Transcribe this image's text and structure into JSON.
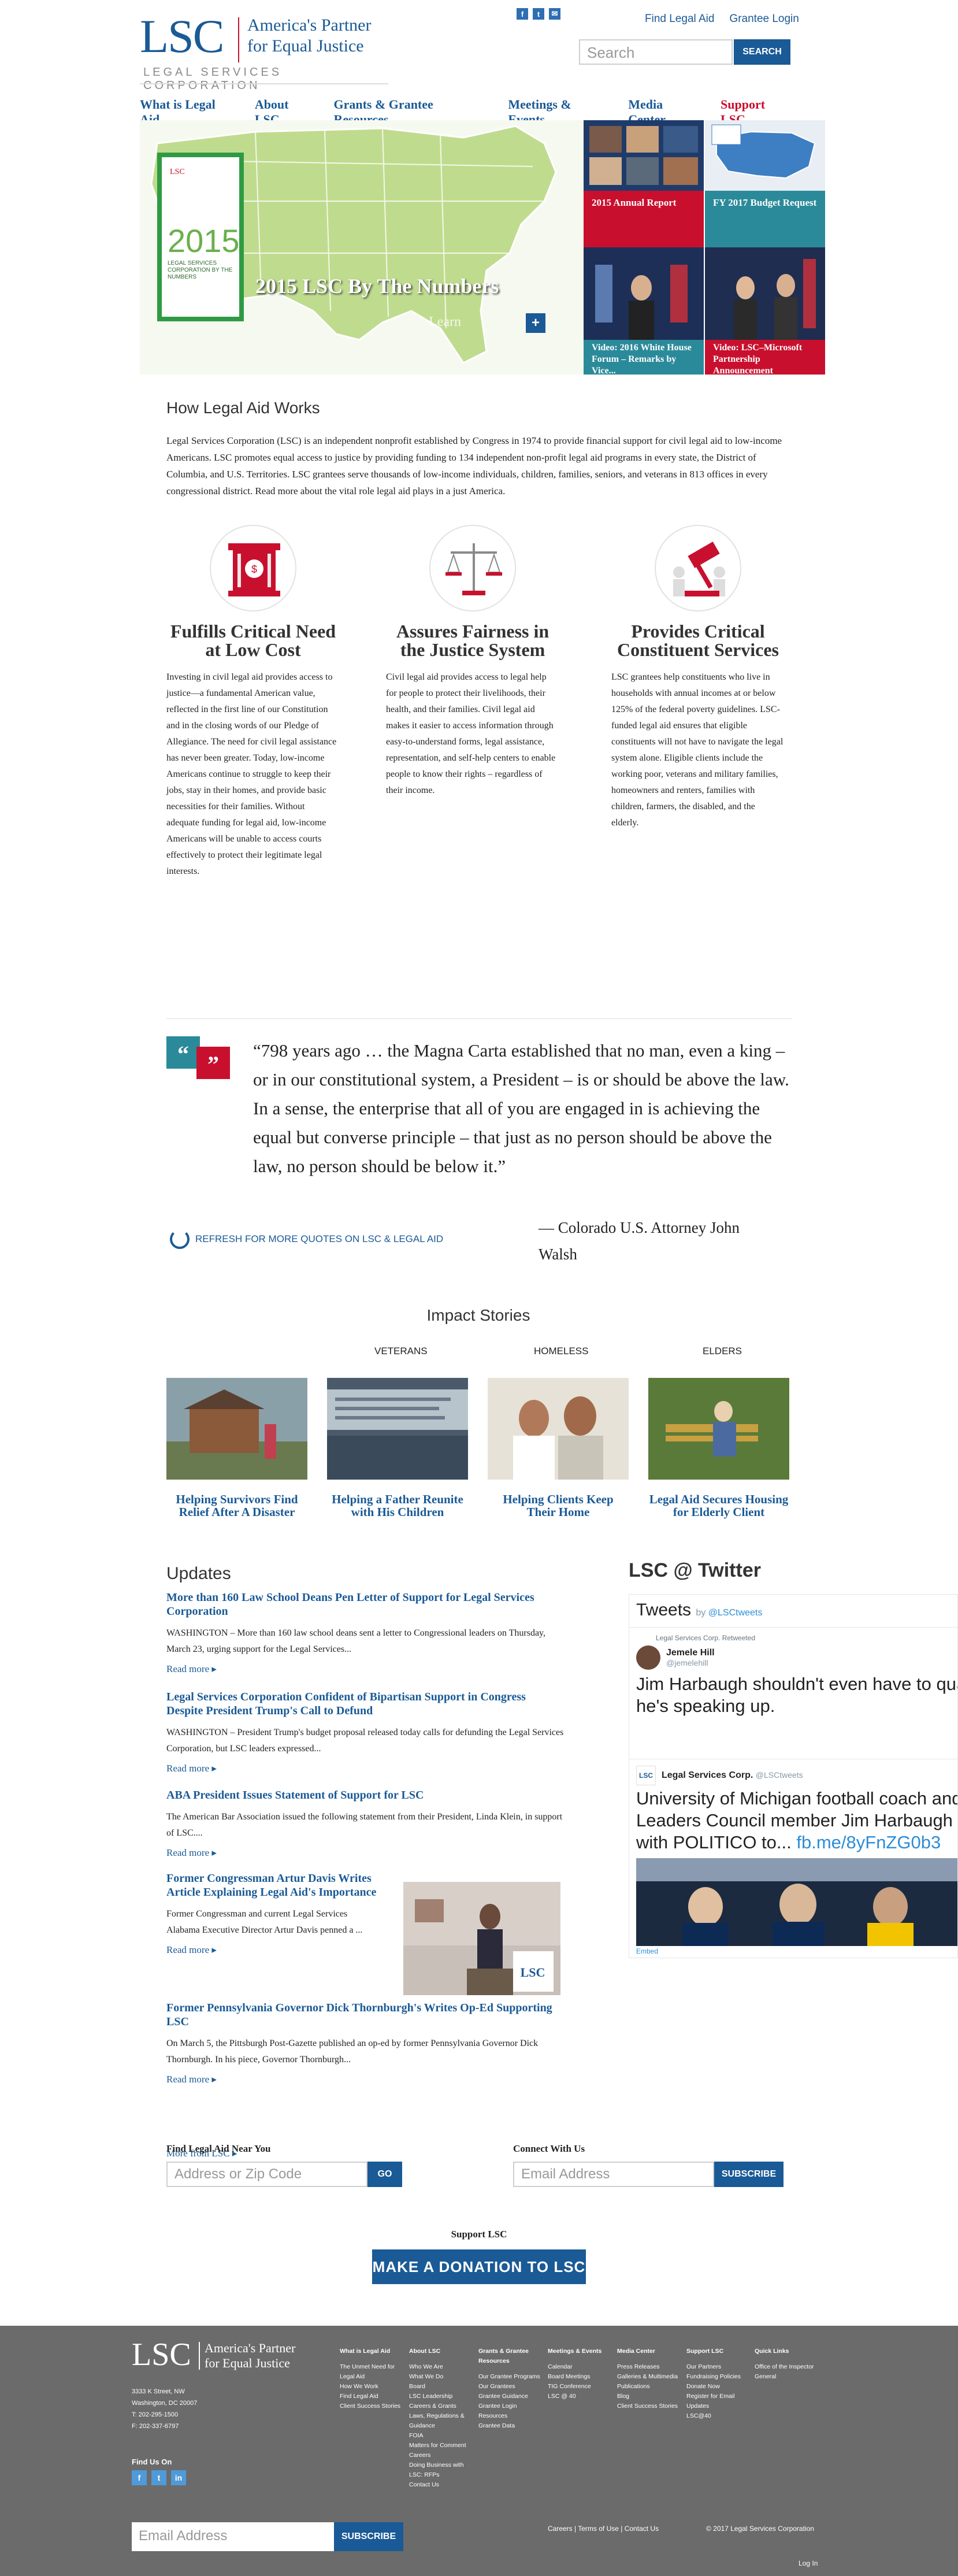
{
  "header": {
    "logo_text": "LSC",
    "logo_tagline_1": "America's Partner",
    "logo_tagline_2": "for Equal Justice",
    "logo_corp": "LEGAL SERVICES CORPORATION",
    "social": [
      "f",
      "t",
      "✉"
    ],
    "find_legal_aid": "Find Legal Aid",
    "grantee_login": "Grantee Login",
    "search_placeholder": "Search",
    "search_button": "SEARCH"
  },
  "nav": {
    "items": [
      "What is Legal Aid",
      "About LSC",
      "Grants & Grantee Resources",
      "Meetings & Events",
      "Media Center"
    ],
    "support": "Support LSC"
  },
  "hero": {
    "report_label": "LSC",
    "report_year": "2015",
    "report_sub": "LEGAL SERVICES CORPORATION BY THE NUMBERS",
    "caption": "2015 LSC By The Numbers",
    "learn": "Learn",
    "plus": "+",
    "tiles": [
      {
        "label": "2015 Annual Report"
      },
      {
        "label": "FY 2017 Budget Request"
      },
      {
        "label": "Video: 2016 White House Forum – Remarks by Vice..."
      },
      {
        "label": "Video: LSC–Microsoft Partnership Announcement"
      }
    ]
  },
  "how": {
    "title": "How Legal Aid Works",
    "intro": "Legal Services Corporation (LSC) is an independent nonprofit established by Congress in 1974 to provide financial support for civil legal aid to low-income Americans. LSC promotes equal access to justice by providing funding to 134 independent non-profit legal aid programs in every state, the District of Columbia, and U.S. Territories. LSC grantees serve thousands of low-income individuals, children, families, seniors, and veterans in 813 offices in every congressional district. Read more about the vital role legal aid plays in a just America.",
    "cols": [
      {
        "title": "Fulfills Critical Need at Low Cost",
        "text": "Investing in civil legal aid provides access to justice—a fundamental American value, reflected in the first line of our Constitution and in the closing words of our Pledge of Allegiance. The need for civil legal assistance has never been greater. Today, low-income Americans continue to struggle to keep their jobs, stay in their homes, and provide basic necessities for their families. Without adequate funding for legal aid, low-income Americans will be unable to access courts effectively to protect their legitimate legal interests."
      },
      {
        "title": "Assures Fairness in the Justice System",
        "text": "Civil legal aid provides access to legal help for people to protect their livelihoods, their health, and their families. Civil legal aid makes it easier to access information through easy-to-understand forms, legal assistance, representation, and self-help centers to enable people to know their rights – regardless of their income."
      },
      {
        "title": "Provides Critical Constituent Services",
        "text": "LSC grantees help constituents who live in households with annual incomes at or below 125% of the federal poverty guidelines. LSC-funded legal aid ensures that eligible constituents will not have to navigate the legal system alone. Eligible clients include the working poor, veterans and military families, homeowners and renters, families with children, farmers, the disabled, and the elderly."
      }
    ]
  },
  "quote": {
    "text": "“798 years ago … the Magna Carta established that no man, even a king – or in our constitutional system, a President – is or should be above the law. In a sense, the enterprise that all of you are engaged in is achieving the equal but converse principle – that just as no person should be above the law, no person should be below it.”",
    "author": "— Colorado U.S. Attorney John Walsh",
    "refresh": "REFRESH FOR MORE QUOTES ON LSC & LEGAL AID"
  },
  "impact": {
    "title": "Impact Stories",
    "categories": [
      "VETERANS",
      "HOMELESS",
      "ELDERS"
    ],
    "stories": [
      {
        "caption": "Helping Survivors Find Relief After A Disaster"
      },
      {
        "caption": "Helping a Father Reunite with His Children"
      },
      {
        "caption": "Helping Clients Keep Their Home"
      },
      {
        "caption": "Legal Aid Secures Housing for Elderly Client"
      }
    ]
  },
  "updates": {
    "title": "Updates",
    "items": [
      {
        "title": "More than 160 Law School Deans Pen Letter of Support for Legal Services Corporation",
        "text": "WASHINGTON – More than 160 law school deans sent a letter to Congressional leaders on Thursday, March 23, urging support for the Legal Services...",
        "more": "Read more ▸"
      },
      {
        "title": "Legal Services Corporation Confident of Bipartisan Support in Congress Despite President Trump's Call to Defund",
        "text": "WASHINGTON – President Trump's budget proposal released today calls for defunding the Legal Services Corporation, but LSC leaders expressed...",
        "more": "Read more ▸"
      },
      {
        "title": "ABA President Issues Statement of Support for LSC",
        "text": "The American Bar Association issued the following statement from their President, Linda Klein, in support of LSC....",
        "more": "Read more ▸"
      },
      {
        "title": "Former Congressman Artur Davis Writes Article Explaining Legal Aid's Importance",
        "text": "Former Congressman and current Legal Services Alabama Executive Director Artur Davis penned a ...",
        "more": "Read more ▸"
      },
      {
        "title": "Former Pennsylvania Governor Dick Thornburgh's Writes Op-Ed Supporting LSC",
        "text": "On March 5, the Pittsburgh Post-Gazette published an op-ed by former Pennsylvania Governor Dick Thornburgh. In his piece, Governor Thornburgh...",
        "more": "Read more ▸"
      }
    ],
    "more_from": "More from LSC ▸"
  },
  "twitter": {
    "title": "LSC @ Twitter",
    "box_title": "Tweets",
    "by": "by",
    "by_handle": "@LSCtweets",
    "t1_rt": "Legal Services Corp. Retweeted",
    "t1_name": "Jemele Hill",
    "t1_handle": "@jemelehill",
    "t1_text": "Jim Harbaugh shouldn't even have to qua... he's speaking up.",
    "t2_name": "Legal Services Corp.",
    "t2_handle": "@LSCtweets",
    "t2_text": "University of Michigan football coach and ... Leaders Council member Jim Harbaugh s... with POLITICO to...",
    "t2_link": "fb.me/8yFnZG0b3",
    "embed": "Embed"
  },
  "find": {
    "title": "Find Legal Aid Near You",
    "placeholder": "Address or Zip Code",
    "button": "GO"
  },
  "connect": {
    "title": "Connect With Us",
    "placeholder": "Email Address",
    "button": "SUBSCRIBE"
  },
  "donate": {
    "title": "Support LSC",
    "button": "MAKE A DONATION TO LSC"
  },
  "footer": {
    "logo_text": "LSC",
    "tag1": "America's Partner",
    "tag2": "for Equal Justice",
    "address": [
      "3333 K Street, NW",
      "Washington, DC 20007",
      "T: 202-295-1500",
      "F: 202-337-6797"
    ],
    "find_us": "Find Us On",
    "social": [
      "f",
      "t",
      "in"
    ],
    "sub_placeholder": "Email Address",
    "sub_button": "SUBSCRIBE",
    "columns": [
      {
        "head": "What is Legal Aid",
        "links": [
          "The Unmet Need for Legal Aid",
          "How We Work",
          "Find Legal Aid",
          "Client Success Stories"
        ]
      },
      {
        "head": "About LSC",
        "links": [
          "Who We Are",
          "What We Do",
          "Board",
          "LSC Leadership",
          "Careers & Grants",
          "Laws, Regulations & Guidance",
          "FOIA",
          "Matters for Comment",
          "Careers",
          "Doing Business with LSC: RFPs",
          "Contact Us"
        ]
      },
      {
        "head": "Grants & Grantee Resources",
        "links": [
          "Our Grantee Programs",
          "Our Grantees",
          "Grantee Guidance",
          "Grantee Login",
          "Resources",
          "Grantee Data"
        ]
      },
      {
        "head": "Meetings & Events",
        "links": [
          "Calendar",
          "Board Meetings",
          "TIG Conference",
          "LSC @ 40"
        ]
      },
      {
        "head": "Media Center",
        "links": [
          "Press Releases",
          "Galleries & Multimedia",
          "Publications",
          "Blog",
          "Client Success Stories"
        ]
      },
      {
        "head": "Support LSC",
        "links": [
          "Our Partners",
          "Fundraising Policies",
          "Donate Now",
          "Register for Email Updates",
          "LSC@40"
        ]
      },
      {
        "head": "Quick Links",
        "links": [
          "Office of the Inspector General"
        ]
      }
    ],
    "bottom_links": "Careers | Terms of Use | Contact Us",
    "copyright": "© 2017 Legal Services Corporation",
    "login": "Log In"
  }
}
